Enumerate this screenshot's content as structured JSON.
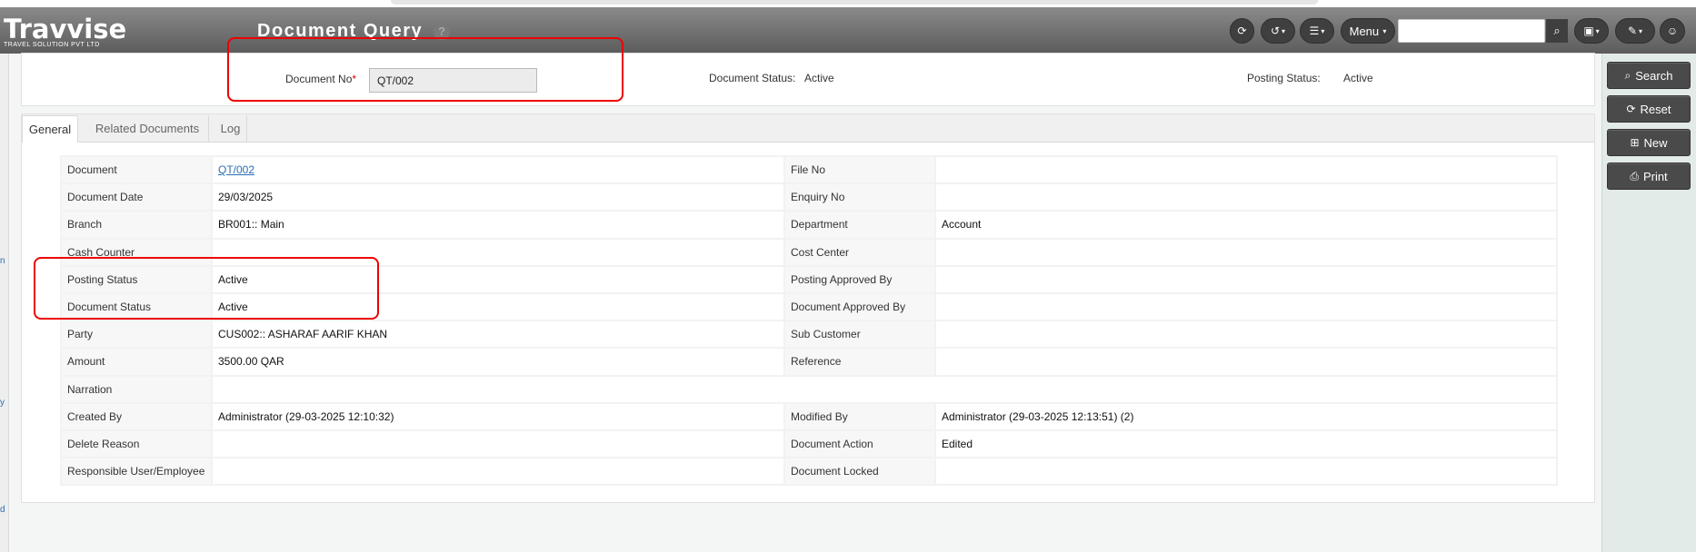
{
  "app": {
    "logo_name": "Travvise",
    "logo_tagline": "TRAVEL SOLUTION PVT LTD",
    "page_title": "Document Query",
    "help_glyph": "?"
  },
  "toolbar": {
    "menu_label": "Menu",
    "search_value": "",
    "icons": [
      "refresh-icon",
      "history-icon",
      "list-icon",
      "search-icon",
      "language-icon",
      "brush-icon",
      "user-icon"
    ]
  },
  "filter": {
    "document_no_label": "Document No",
    "required_mark": "*",
    "document_no_value": "QT/002",
    "document_status_label": "Document Status:",
    "document_status_value": "Active",
    "posting_status_label": "Posting Status:",
    "posting_status_value": "Active"
  },
  "tabs": [
    {
      "label": "General",
      "active": true
    },
    {
      "label": "Related Documents",
      "active": false
    },
    {
      "label": "Log",
      "active": false
    }
  ],
  "details": [
    {
      "l1": "Document",
      "v1": "QT/002",
      "l2": "File No",
      "v2": ""
    },
    {
      "l1": "Document Date",
      "v1": "29/03/2025",
      "l2": "Enquiry No",
      "v2": ""
    },
    {
      "l1": "Branch",
      "v1": "BR001:: Main",
      "l2": "Department",
      "v2": "Account"
    },
    {
      "l1": "Cash Counter",
      "v1": "",
      "l2": "Cost Center",
      "v2": ""
    },
    {
      "l1": "Posting Status",
      "v1": "Active",
      "l2": "Posting Approved By",
      "v2": ""
    },
    {
      "l1": "Document Status",
      "v1": "Active",
      "l2": "Document Approved By",
      "v2": ""
    },
    {
      "l1": "Party",
      "v1": "CUS002:: ASHARAF AARIF KHAN",
      "l2": "Sub Customer",
      "v2": ""
    },
    {
      "l1": "Amount",
      "v1": "3500.00 QAR",
      "l2": "Reference",
      "v2": ""
    },
    {
      "l1": "Narration",
      "v1": ""
    },
    {
      "l1": "Created By",
      "v1": "Administrator (29-03-2025 12:10:32)",
      "l2": "Modified By",
      "v2": "Administrator (29-03-2025 12:13:51) (2)"
    },
    {
      "l1": "Delete Reason",
      "v1": "",
      "l2": "Document Action",
      "v2": "Edited"
    },
    {
      "l1": "Responsible User/Employee",
      "v1": "",
      "l2": "Document Locked",
      "v2": ""
    }
  ],
  "side_actions": {
    "search": "Search",
    "reset": "Reset",
    "new": "New",
    "print": "Print"
  },
  "left_edge_glyphs": [
    "n",
    "y",
    "d"
  ],
  "colors": {
    "topbar": "#5c5c5c",
    "highlight_box": "#e00000",
    "link": "#2a6fb5"
  }
}
